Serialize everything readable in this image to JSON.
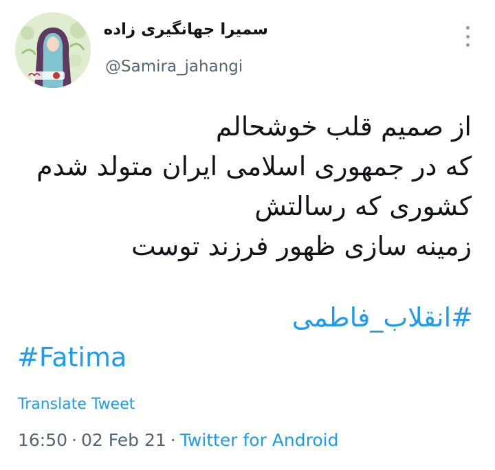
{
  "author": {
    "display_name": "سمیرا جهانگیری زاده",
    "handle": "@Samira_jahangi",
    "avatar_icon": "profile-illustration"
  },
  "menu_icon": "more-vertical-icon",
  "tweet": {
    "lines": [
      "از صمیم قلب خوشحالم",
      "که در جمهوری اسلامی ایران متولد شدم",
      "کشوری که رسالتش",
      " زمینه سازی ظهور فرزند توست"
    ],
    "hashtags": [
      "#انقلاب_فاطمی",
      "#Fatima"
    ]
  },
  "translate_label": "Translate Tweet",
  "meta": {
    "time": "16:50",
    "date": "02 Feb 21",
    "separator": "·",
    "source": "Twitter for Android"
  },
  "colors": {
    "link": "#1d9bf0",
    "text": "#0f1419",
    "secondary": "#536471"
  }
}
